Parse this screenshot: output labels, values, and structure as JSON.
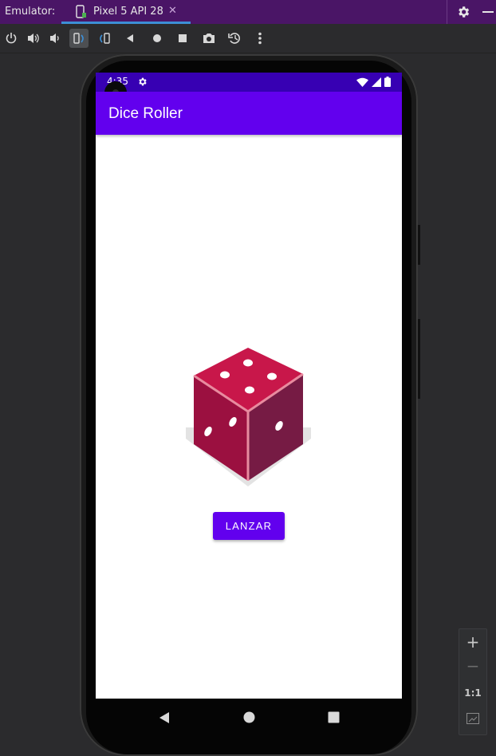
{
  "titlebar": {
    "emulator_label": "Emulator:",
    "device_tab": "Pixel 5 API 28",
    "close_symbol": "✕"
  },
  "toolbar": {
    "buttons": [
      "power-icon",
      "volume-up-icon",
      "volume-down-icon",
      "rotate-left-icon",
      "rotate-right-icon",
      "back-icon",
      "home-icon",
      "overview-icon",
      "screenshot-icon",
      "snapshot-icon",
      "more-icon"
    ]
  },
  "status_bar": {
    "time": "4:35",
    "icons": [
      "settings-icon",
      "wifi-icon",
      "signal-icon",
      "battery-icon"
    ]
  },
  "app": {
    "title": "Dice Roller",
    "roll_button": "LANZAR",
    "accent_color": "#6200ee",
    "status_color": "#3700b3"
  },
  "nav_bar": {
    "buttons": [
      "back-triangle-icon",
      "home-circle-icon",
      "recents-square-icon"
    ]
  },
  "zoom": {
    "zoom_in": "+",
    "zoom_out": "−",
    "one_to_one": "1:1"
  }
}
